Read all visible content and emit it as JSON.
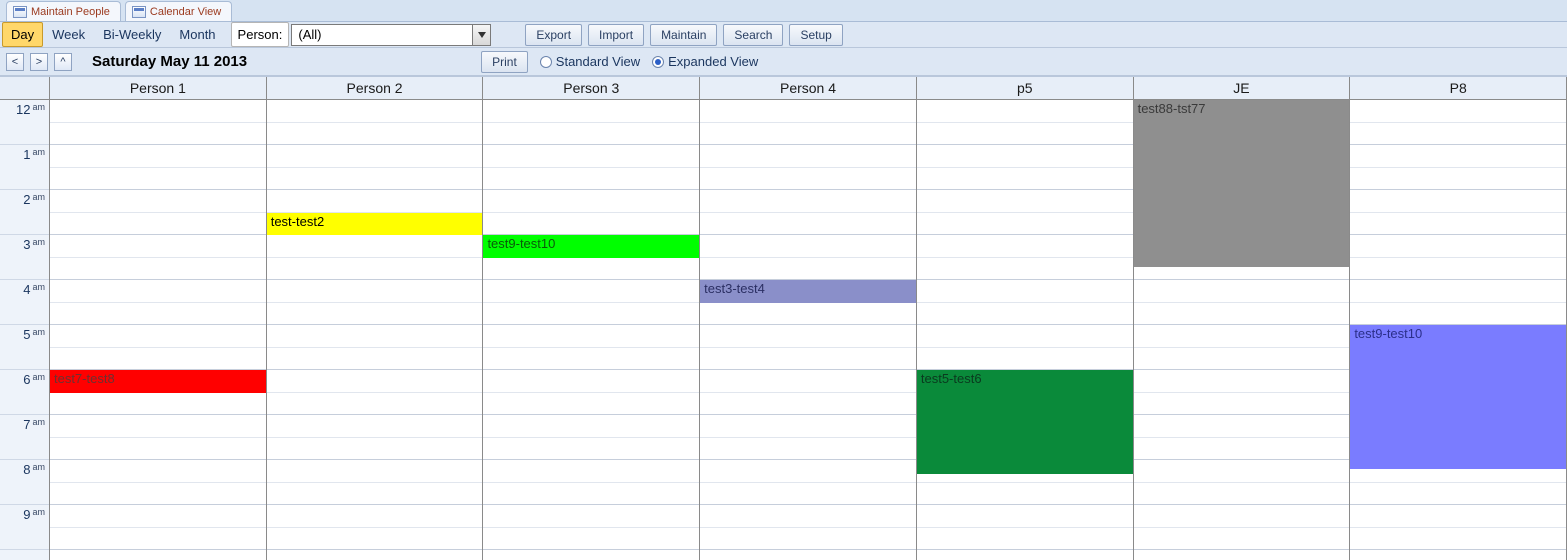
{
  "tabs": [
    {
      "label": "Maintain People"
    },
    {
      "label": "Calendar View"
    }
  ],
  "viewTabs": {
    "day": "Day",
    "week": "Week",
    "biweekly": "Bi-Weekly",
    "month": "Month",
    "active": "day"
  },
  "personFilter": {
    "label": "Person:",
    "value": "(All)"
  },
  "toolbarButtons": {
    "export": "Export",
    "import": "Import",
    "maintain": "Maintain",
    "search": "Search",
    "setup": "Setup"
  },
  "nav": {
    "prev": "<",
    "next": ">",
    "up": "^"
  },
  "dateTitle": "Saturday May 11 2013",
  "printLabel": "Print",
  "viewMode": {
    "standard": "Standard View",
    "expanded": "Expanded View",
    "selected": "expanded"
  },
  "people": [
    "Person 1",
    "Person 2",
    "Person 3",
    "Person 4",
    "p5",
    "JE",
    "P8"
  ],
  "hours": [
    {
      "hr": "12",
      "ap": "am"
    },
    {
      "hr": "1",
      "ap": "am"
    },
    {
      "hr": "2",
      "ap": "am"
    },
    {
      "hr": "3",
      "ap": "am"
    },
    {
      "hr": "4",
      "ap": "am"
    },
    {
      "hr": "5",
      "ap": "am"
    },
    {
      "hr": "6",
      "ap": "am"
    },
    {
      "hr": "7",
      "ap": "am"
    },
    {
      "hr": "8",
      "ap": "am"
    },
    {
      "hr": "9",
      "ap": "am"
    }
  ],
  "events": [
    {
      "personIndex": 0,
      "label": "test7-test8",
      "startHour": 6.0,
      "endHour": 6.5,
      "bg": "#ff0000",
      "fg": "#6b3232"
    },
    {
      "personIndex": 1,
      "label": "test-test2",
      "startHour": 2.5,
      "endHour": 3.0,
      "bg": "#ffff00",
      "fg": "#000000"
    },
    {
      "personIndex": 2,
      "label": "test9-test10",
      "startHour": 3.0,
      "endHour": 3.5,
      "bg": "#00ff00",
      "fg": "#0a5a0a"
    },
    {
      "personIndex": 3,
      "label": "test3-test4",
      "startHour": 4.0,
      "endHour": 4.5,
      "bg": "#8a8fc9",
      "fg": "#2b2f63"
    },
    {
      "personIndex": 4,
      "label": "test5-test6",
      "startHour": 6.0,
      "endHour": 8.3,
      "bg": "#0a8a3a",
      "fg": "#0a3a1f"
    },
    {
      "personIndex": 5,
      "label": "test88-tst77",
      "startHour": 0.0,
      "endHour": 3.7,
      "bg": "#8f8f8f",
      "fg": "#3a3a3a"
    },
    {
      "personIndex": 6,
      "label": "test9-test10",
      "startHour": 5.0,
      "endHour": 8.2,
      "bg": "#7a7cff",
      "fg": "#2b2f8a"
    }
  ]
}
